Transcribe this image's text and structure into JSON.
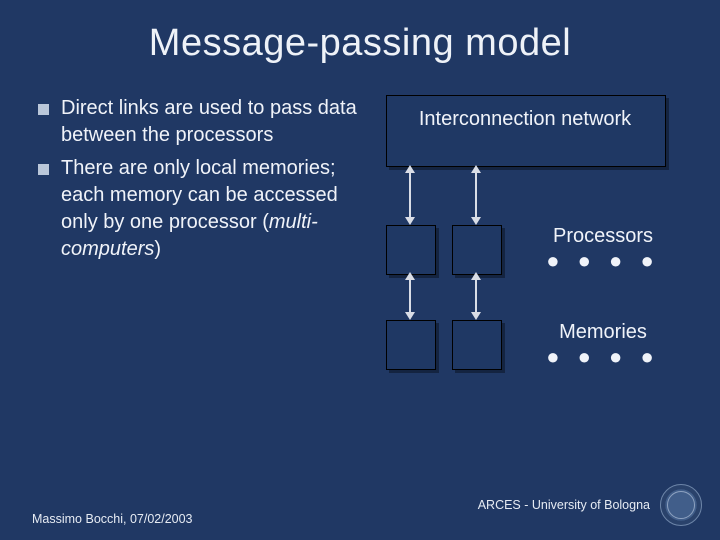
{
  "title": "Message-passing model",
  "bullets": [
    {
      "text": "Direct links are used to pass data between the processors"
    },
    {
      "text_pre": "There are only local memories; each memory can be accessed only by one processor (",
      "text_it": "multi-computers",
      "text_post": ")"
    }
  ],
  "diagram": {
    "network_label": "Interconnection network",
    "processors_label": "Processors",
    "memories_label": "Memories",
    "dots": "● ● ● ●"
  },
  "footer": {
    "left": "Massimo Bocchi, 07/02/2003",
    "right": "ARCES - University of Bologna"
  }
}
